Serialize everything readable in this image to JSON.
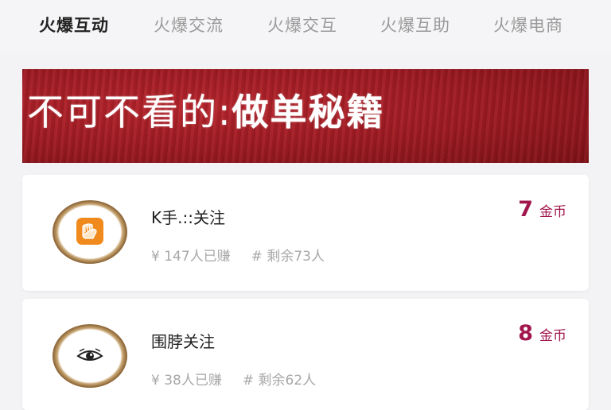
{
  "tabs": [
    {
      "label": "火爆互动",
      "active": true
    },
    {
      "label": "火爆交流",
      "active": false
    },
    {
      "label": "火爆交互",
      "active": false
    },
    {
      "label": "火爆互助",
      "active": false
    },
    {
      "label": "火爆电商",
      "active": false
    }
  ],
  "banner": {
    "text_light": "不可不看的:",
    "text_bold": "做单秘籍"
  },
  "tasks": [
    {
      "title": "K手.::关注",
      "earned": "¥ 147人已赚",
      "remaining": "# 剩余73人",
      "reward_value": "7",
      "reward_unit": "金币",
      "icon": "kuaishou-hand-icon"
    },
    {
      "title": "围脖关注",
      "earned": "¥ 38人已赚",
      "remaining": "# 剩余62人",
      "reward_value": "8",
      "reward_unit": "金币",
      "icon": "weibo-eye-icon"
    }
  ],
  "colors": {
    "accent": "#a1164c",
    "banner_red": "#9d1a22",
    "muted_text": "#a8a8a8"
  }
}
